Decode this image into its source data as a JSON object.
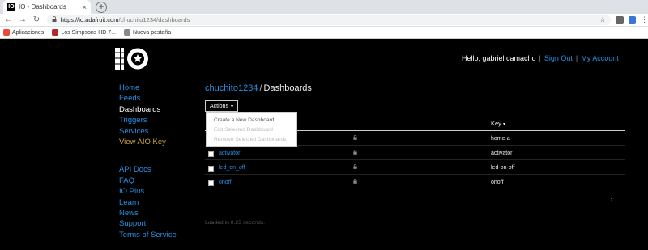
{
  "browser": {
    "tab_title": "IO - Dashboards",
    "tab_close": "×",
    "new_tab": "+",
    "favicon_text": "IO",
    "url_host": "https://io.adafruit.com",
    "url_path": "/chuchito1234/dashboards",
    "bookmarks": [
      {
        "label": "Aplicaciones",
        "icon_color": "#e84a3b",
        "icon": "apps-grid-icon"
      },
      {
        "label": "Los Simpsons HD 7...",
        "icon_color": "#b22a2a",
        "icon": "simpsons-icon"
      },
      {
        "label": "Nueva pestaña",
        "icon_color": "#888888",
        "icon": "page-icon"
      }
    ]
  },
  "header": {
    "greeting": "Hello, gabriel camacho",
    "sep": "|",
    "sign_out": "Sign Out",
    "my_account": "My Account"
  },
  "sidebar": {
    "primary": [
      {
        "label": "Home",
        "state": "link"
      },
      {
        "label": "Feeds",
        "state": "link"
      },
      {
        "label": "Dashboards",
        "state": "active"
      },
      {
        "label": "Triggers",
        "state": "link"
      },
      {
        "label": "Services",
        "state": "link"
      },
      {
        "label": "View AIO Key",
        "state": "gold"
      }
    ],
    "secondary": [
      {
        "label": "API Docs"
      },
      {
        "label": "FAQ"
      },
      {
        "label": "IO Plus"
      },
      {
        "label": "Learn"
      },
      {
        "label": "News"
      },
      {
        "label": "Support"
      },
      {
        "label": "Terms of Service"
      }
    ]
  },
  "breadcrumb": {
    "user": "chuchito1234",
    "slash": "/",
    "page": "Dashboards"
  },
  "actions": {
    "label": "Actions",
    "caret": "▾",
    "menu": [
      {
        "label": "Create a New Dashboard",
        "enabled": true
      },
      {
        "label": "Edit Selected Dashboard",
        "enabled": false
      },
      {
        "label": "Remove Selected Dashboards",
        "enabled": false
      }
    ]
  },
  "table": {
    "key_header": "Key",
    "sort_icon": "▾",
    "rows": [
      {
        "name": "",
        "key": "home-a"
      },
      {
        "name": "activator",
        "key": "activator"
      },
      {
        "name": "led_on_off",
        "key": "led-on-off"
      },
      {
        "name": "onoff",
        "key": "onoff"
      }
    ]
  },
  "pager": "⋮",
  "loaded_text": "Loaded in 0.23 seconds.",
  "colors": {
    "link": "#2a90e0",
    "gold": "#c9a642",
    "background": "#000000"
  }
}
